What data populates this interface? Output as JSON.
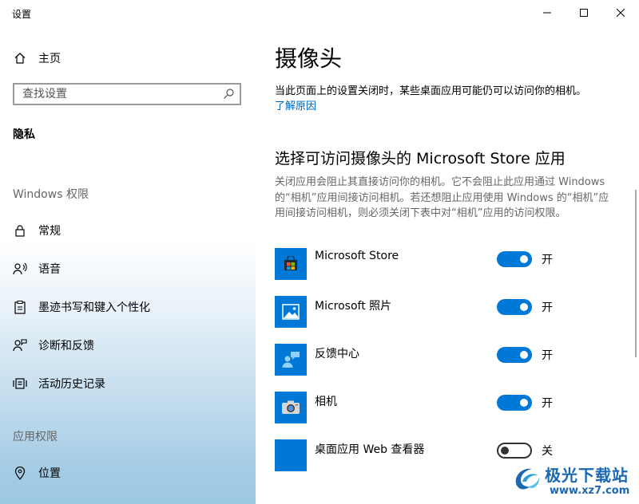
{
  "window": {
    "title": "设置"
  },
  "sidebar": {
    "home_label": "主页",
    "search_placeholder": "查找设置",
    "current_section": "隐私",
    "group_windows": "Windows 权限",
    "group_apps": "应用权限",
    "items": [
      {
        "label": "常规",
        "icon": "lock-icon"
      },
      {
        "label": "语音",
        "icon": "speech-icon"
      },
      {
        "label": "墨迹书写和键入个性化",
        "icon": "clipboard-icon"
      },
      {
        "label": "诊断和反馈",
        "icon": "feedback-person-icon"
      },
      {
        "label": "活动历史记录",
        "icon": "activity-history-icon"
      },
      {
        "label": "位置",
        "icon": "location-icon"
      }
    ]
  },
  "main": {
    "title": "摄像头",
    "description": "当此页面上的设置关闭时，某些桌面应用可能仍可以访问你的相机。",
    "learn_more": "了解原因",
    "section_title": "选择可访问摄像头的 Microsoft Store 应用",
    "section_desc": "关闭应用会阻止其直接访问你的相机。它不会阻止此应用通过 Windows 的“相机”应用间接访问相机。若还想阻止应用使用 Windows 的“相机”应用间接访问相机，则必须关闭下表中对“相机”应用的访问权限。",
    "apps": [
      {
        "name": "Microsoft Store",
        "state": "开",
        "on": true,
        "icon": "microsoft-store-icon"
      },
      {
        "name": "Microsoft 照片",
        "state": "开",
        "on": true,
        "icon": "photos-icon"
      },
      {
        "name": "反馈中心",
        "state": "开",
        "on": true,
        "icon": "feedback-hub-icon"
      },
      {
        "name": "相机",
        "state": "开",
        "on": true,
        "icon": "camera-icon"
      },
      {
        "name": "桌面应用 Web 查看器",
        "state": "关",
        "on": false,
        "icon": "web-viewer-icon"
      }
    ]
  },
  "watermark": {
    "brand": "极光下载站",
    "url": "www.xz7.com"
  },
  "colors": {
    "accent": "#0078d7",
    "link": "#0067b8"
  }
}
